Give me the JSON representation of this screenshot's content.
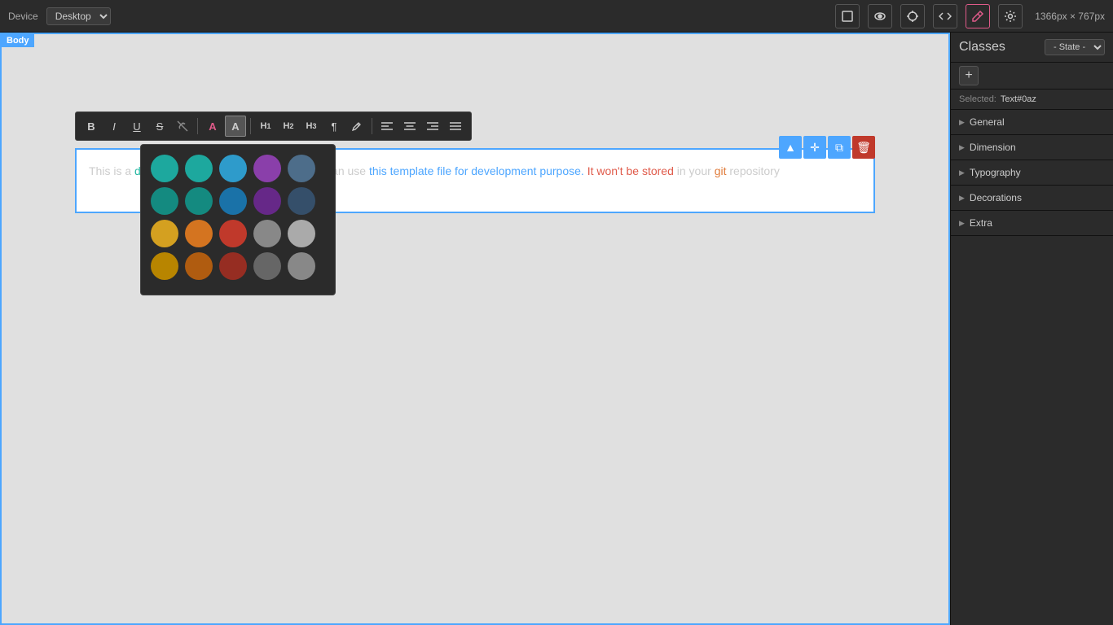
{
  "topbar": {
    "device_label": "Device",
    "device_value": "Desktop",
    "dimensions": "1366px × 767px",
    "icons": {
      "square": "⬜",
      "eye": "👁",
      "move": "✛",
      "code": "</>",
      "pen": "✏",
      "gear": "⚙"
    }
  },
  "body_tag": "Body",
  "canvas": {
    "text_content": "This is a demo document from index.html. You can use this template file for development purpose. It won't be stored in your git repository."
  },
  "toolbar_buttons": [
    {
      "label": "B",
      "name": "bold-btn"
    },
    {
      "label": "I",
      "name": "italic-btn"
    },
    {
      "label": "U",
      "name": "underline-btn"
    },
    {
      "label": "S",
      "name": "strikethrough-btn"
    },
    {
      "label": "✗",
      "name": "no-link-btn"
    },
    {
      "label": "A",
      "name": "text-color-btn"
    },
    {
      "label": "A",
      "name": "text-bg-color-btn"
    },
    {
      "label": "H1",
      "name": "h1-btn"
    },
    {
      "label": "H2",
      "name": "h2-btn"
    },
    {
      "label": "H3",
      "name": "h3-btn"
    },
    {
      "label": "¶",
      "name": "paragraph-btn"
    },
    {
      "label": "✏",
      "name": "highlight-btn"
    },
    {
      "label": "≡",
      "name": "align-left-btn"
    },
    {
      "label": "≡",
      "name": "align-center-btn"
    },
    {
      "label": "≡",
      "name": "align-right-btn"
    },
    {
      "label": "≡",
      "name": "align-justify-btn"
    }
  ],
  "color_rows": [
    [
      {
        "color": "#1da89e",
        "name": "teal-light"
      },
      {
        "color": "#1da89e",
        "name": "teal-medium",
        "pattern": true
      },
      {
        "color": "#1e8cc2",
        "name": "blue-medium"
      },
      {
        "color": "#7b3fa0",
        "name": "purple-medium"
      },
      {
        "color": "#4a6b8a",
        "name": "slate-medium"
      }
    ],
    [
      {
        "color": "#178a80",
        "name": "teal-dark"
      },
      {
        "color": "#178a80",
        "name": "teal-dark-pattern",
        "pattern": true
      },
      {
        "color": "#1a6fa0",
        "name": "blue-dark"
      },
      {
        "color": "#5e2f80",
        "name": "purple-dark"
      },
      {
        "color": "#374f66",
        "name": "slate-dark"
      }
    ],
    [
      {
        "color": "#d4a017",
        "name": "yellow"
      },
      {
        "color": "#d4741a",
        "name": "orange-light",
        "pattern": true
      },
      {
        "color": "#c0392b",
        "name": "red-medium"
      },
      {
        "color": "#888888",
        "name": "gray-medium"
      },
      {
        "color": "#aaaaaa",
        "name": "gray-light"
      }
    ],
    [
      {
        "color": "#b88500",
        "name": "yellow-dark"
      },
      {
        "color": "#b05c10",
        "name": "orange-dark",
        "pattern": true
      },
      {
        "color": "#962d22",
        "name": "red-dark"
      },
      {
        "color": "#666666",
        "name": "gray-dark"
      },
      {
        "color": "#888888",
        "name": "gray-medium2"
      }
    ]
  ],
  "right_panel": {
    "classes_label": "Classes",
    "state_label": "- State -",
    "selected_label": "Selected:",
    "selected_value": "Text#0az",
    "add_btn": "+",
    "sections": [
      {
        "label": "General",
        "name": "general"
      },
      {
        "label": "Dimension",
        "name": "dimension"
      },
      {
        "label": "Typography",
        "name": "typography"
      },
      {
        "label": "Decorations",
        "name": "decorations"
      },
      {
        "label": "Extra",
        "name": "extra"
      }
    ]
  },
  "element_controls": {
    "up": "▲",
    "move": "✛",
    "copy": "⧉",
    "delete": "🗑"
  }
}
